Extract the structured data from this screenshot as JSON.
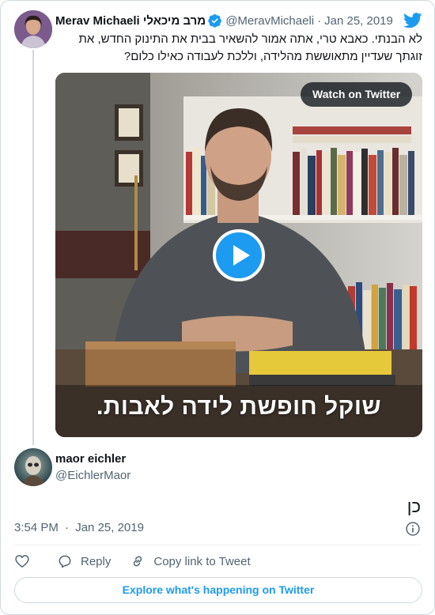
{
  "quoted_tweet": {
    "display_name": "Merav Michaeli מרב מיכאלי",
    "handle": "@MeravMichaeli",
    "separator": "·",
    "date": "Jan 25, 2019",
    "text": "לא הבנתי. כאבא טרי, אתה אמור להשאיר בבית את התינוק החדש, את זוגתך שעדיין מתאוששת מהלידה, וללכת לעבודה כאילו כלום?",
    "avatar_icon": "profile-photo",
    "verified_icon": "verified-badge-icon"
  },
  "video": {
    "watch_label": "Watch on Twitter",
    "caption": "שוקל חופשת לידה לאבות.",
    "play_icon": "play-icon"
  },
  "reply": {
    "display_name": "maor eichler",
    "handle": "@EichlerMaor",
    "text": "כן",
    "time": "3:54 PM",
    "separator": "·",
    "date": "Jan 25, 2019"
  },
  "actions": {
    "reply_label": "Reply",
    "copy_label": "Copy link to Tweet"
  },
  "footer": {
    "explore_label": "Explore what's happening on Twitter"
  },
  "colors": {
    "accent": "#1d9bf0",
    "text": "#0f1419",
    "muted": "#536471",
    "border": "#cfd9de"
  }
}
